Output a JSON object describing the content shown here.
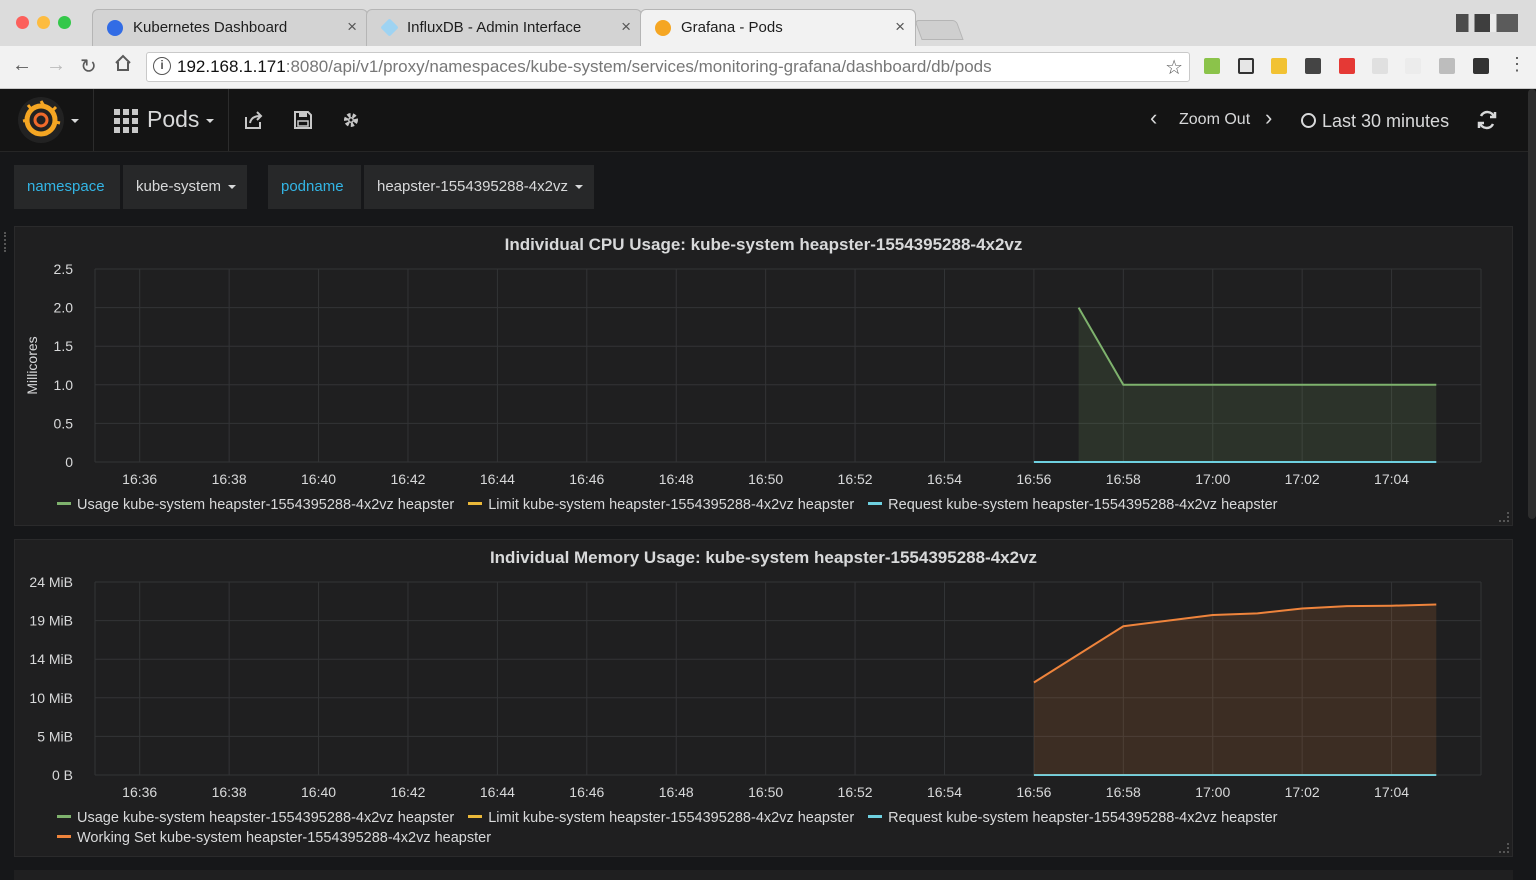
{
  "browser": {
    "tabs": [
      {
        "title": "Kubernetes Dashboard",
        "active": false,
        "icon": "kubernetes-icon"
      },
      {
        "title": "InfluxDB - Admin Interface",
        "active": false,
        "icon": "influxdb-icon"
      },
      {
        "title": "Grafana - Pods",
        "active": true,
        "icon": "grafana-icon"
      }
    ],
    "url_host": "192.168.1.171",
    "url_rest": ":8080/api/v1/proxy/namespaces/kube-system/services/monitoring-grafana/dashboard/db/pods"
  },
  "grafana": {
    "dashboard_title": "Pods",
    "zoom_out_label": "Zoom Out",
    "time_range": "Last 30 minutes"
  },
  "variables": [
    {
      "label": "namespace",
      "value": "kube-system"
    },
    {
      "label": "podname",
      "value": "heapster-1554395288-4x2vz"
    }
  ],
  "colors": {
    "usage": "#7eb26d",
    "limit": "#eab839",
    "request": "#6ed0e0",
    "working_set": "#ef843c",
    "accent": "#33b5e5"
  },
  "chart_data": [
    {
      "type": "area",
      "title": "Individual CPU Usage: kube-system heapster-1554395288-4x2vz",
      "ylabel": "Millicores",
      "xlabel": "",
      "ylim": [
        0,
        2.5
      ],
      "yticks": [
        "2.5",
        "2.0",
        "1.5",
        "1.0",
        "0.5",
        "0"
      ],
      "xticks": [
        "16:36",
        "16:38",
        "16:40",
        "16:42",
        "16:44",
        "16:46",
        "16:48",
        "16:50",
        "16:52",
        "16:54",
        "16:56",
        "16:58",
        "17:00",
        "17:02",
        "17:04"
      ],
      "xlim": [
        "16:35",
        "17:06"
      ],
      "grid": true,
      "legend": "bottom",
      "series": [
        {
          "name": "Usage kube-system heapster-1554395288-4x2vz heapster",
          "color": "#7eb26d",
          "x": [
            "16:57",
            "16:58",
            "17:00",
            "17:02",
            "17:04",
            "17:05"
          ],
          "values": [
            2,
            1,
            1,
            1,
            1,
            1
          ],
          "fill": true
        },
        {
          "name": "Limit kube-system heapster-1554395288-4x2vz heapster",
          "color": "#eab839",
          "x": [],
          "values": []
        },
        {
          "name": "Request kube-system heapster-1554395288-4x2vz heapster",
          "color": "#6ed0e0",
          "x": [
            "16:56",
            "17:05"
          ],
          "values": [
            0,
            0
          ]
        }
      ]
    },
    {
      "type": "area",
      "title": "Individual Memory Usage: kube-system heapster-1554395288-4x2vz",
      "ylabel": "",
      "xlabel": "",
      "ylim": [
        0,
        24
      ],
      "yunit": "MiB",
      "yticks": [
        "24 MiB",
        "19 MiB",
        "14 MiB",
        "10 MiB",
        "5 MiB",
        "0 B"
      ],
      "xticks": [
        "16:36",
        "16:38",
        "16:40",
        "16:42",
        "16:44",
        "16:46",
        "16:48",
        "16:50",
        "16:52",
        "16:54",
        "16:56",
        "16:58",
        "17:00",
        "17:02",
        "17:04"
      ],
      "xlim": [
        "16:35",
        "17:06"
      ],
      "grid": true,
      "legend": "bottom",
      "series": [
        {
          "name": "Usage kube-system heapster-1554395288-4x2vz heapster",
          "color": "#7eb26d",
          "x": [],
          "values": []
        },
        {
          "name": "Limit kube-system heapster-1554395288-4x2vz heapster",
          "color": "#eab839",
          "x": [],
          "values": []
        },
        {
          "name": "Request kube-system heapster-1554395288-4x2vz heapster",
          "color": "#6ed0e0",
          "x": [
            "16:56",
            "17:05"
          ],
          "values": [
            0,
            0
          ]
        },
        {
          "name": "Working Set kube-system heapster-1554395288-4x2vz heapster",
          "color": "#ef843c",
          "x": [
            "16:56",
            "16:58",
            "16:59",
            "17:00",
            "17:01",
            "17:02",
            "17:03",
            "17:04",
            "17:05"
          ],
          "values": [
            11.5,
            18.5,
            19.2,
            19.9,
            20.1,
            20.7,
            21.0,
            21.05,
            21.2
          ],
          "fill": true
        }
      ]
    }
  ]
}
